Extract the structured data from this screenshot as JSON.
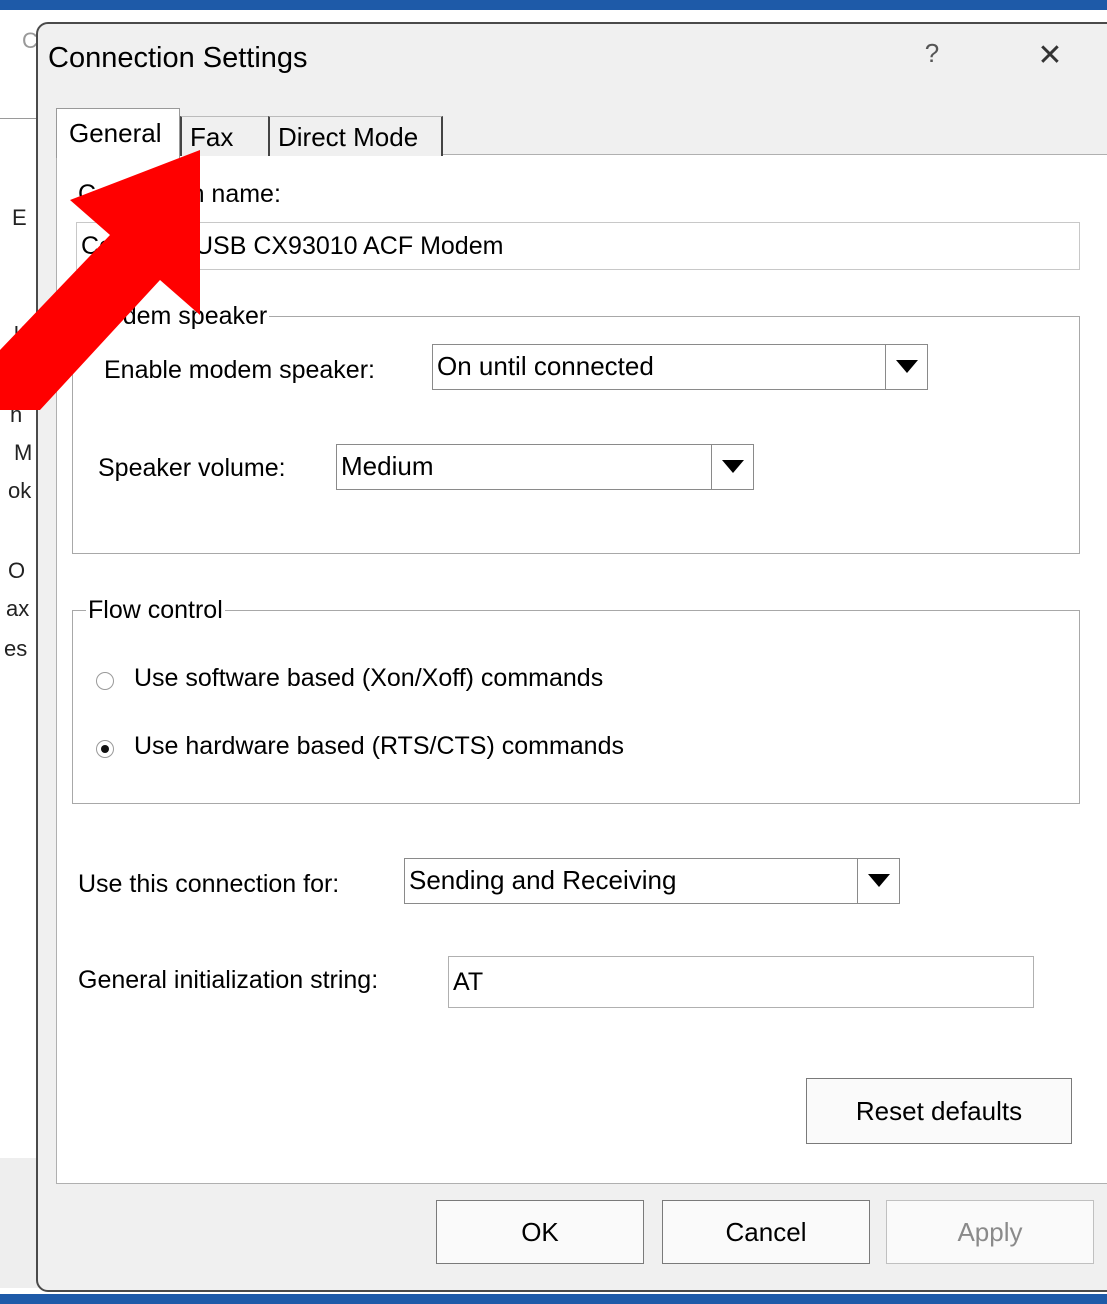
{
  "background_window": {
    "fragments": [
      "C",
      "E",
      "u",
      "h",
      "M",
      "ok",
      "O",
      "ax",
      "es"
    ]
  },
  "dialog": {
    "title": "Connection Settings",
    "help_label": "?",
    "close_label": "✕",
    "tabs": [
      {
        "label": "General",
        "active": true
      },
      {
        "label": "Fax",
        "active": false
      },
      {
        "label": "Direct Mode",
        "active": false
      }
    ],
    "general": {
      "connection_name_label": "Connection name:",
      "connection_name_value": "Conexant USB CX93010 ACF Modem",
      "modem_speaker": {
        "title": "Modem speaker",
        "enable_label": "Enable modem speaker:",
        "enable_value": "On until connected",
        "volume_label": "Speaker volume:",
        "volume_value": "Medium"
      },
      "flow_control": {
        "title": "Flow control",
        "options": [
          {
            "label": "Use software based (Xon/Xoff) commands",
            "checked": false
          },
          {
            "label": "Use hardware based (RTS/CTS) commands",
            "checked": true
          }
        ]
      },
      "use_for_label": "Use this connection for:",
      "use_for_value": "Sending and Receiving",
      "init_label": "General initialization string:",
      "init_value": "AT",
      "reset_label": "Reset defaults"
    },
    "buttons": {
      "ok": "OK",
      "cancel": "Cancel",
      "apply": "Apply"
    }
  },
  "annotation": {
    "arrow_color": "#ff0000"
  }
}
